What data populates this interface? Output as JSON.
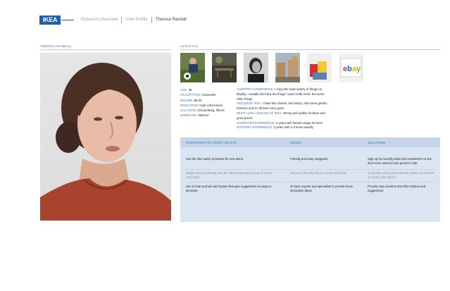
{
  "header": {
    "logo": "IKEA",
    "breadcrumbs": [
      "Research Overview",
      "User Profile"
    ],
    "current": "Theresa Randall"
  },
  "persona": {
    "label": "THERESA RANDALL"
  },
  "lifestyle": {
    "label": "LIFESTYLE",
    "thumbnails": [
      "soccer-family-icon",
      "garden-dining-icon",
      "woman-phone-icon",
      "suburban-street-icon",
      "shopping-bags-icon",
      "ebay-logo-icon"
    ]
  },
  "profile": [
    {
      "key": "AGE:",
      "value": "39"
    },
    {
      "key": "OCCUPATION:",
      "value": "Housewife"
    },
    {
      "key": "INCOME:",
      "value": "$8.5K"
    },
    {
      "key": "EDUCATION:",
      "value": "High school level"
    },
    {
      "key": "LOCATION:",
      "value": "Schaumburg, Illinois"
    },
    {
      "key": "MARRIAGE:",
      "value": "Married"
    }
  ],
  "shopping": [
    {
      "key": "SHOPPING EXPERIENCE:",
      "value": "I enjoy the wide variety of things on display. I usually don't buy the things I want really need, but some other things."
    },
    {
      "key": "FREQUENT IKEA:",
      "value": "I have two closets, two lamps, and some garden furniture and it's all been very good."
    },
    {
      "key": "WHAT I LIKE / DISLIKE OF IKEA:",
      "value": "Strong and quality furniture and good prices."
    },
    {
      "key": "COMPUTER EXPERIENCE:",
      "value": "3 years with limited usage at home"
    },
    {
      "key": "INTERNET EXPERIENCE:",
      "value": "2 years with 2-3 times weekly"
    }
  ],
  "table": {
    "headers": [
      "INTENTIONS FOR USING THE SITE:",
      "NEEDS:",
      "SOLUTIONS:"
    ],
    "rows": [
      [
        "Use the site mainly to browse for new items.",
        "Friendly and easy navigation.",
        "Sign up for monthly sales and newsletters so she don't even need to look up IKEA's site."
      ],
      [
        "Maybe once buy things from the internet because of fear of credit card fraud.",
        "Secure of security that no credit card fraud.",
        "To provide a third party security system as well has no credit card verifies."
      ],
      [
        "Like to look at photo and feature that give suggestions on ways to decorate.",
        "To have experts and specialists to provide home decoration ideas.",
        "Provide easy sections that offer solution and suggestions."
      ]
    ]
  },
  "colors": {
    "brand": "#1f5fa8",
    "accent": "#3a78b5",
    "panel": "#dbe4f1",
    "panel_header": "#c5d4e9"
  }
}
